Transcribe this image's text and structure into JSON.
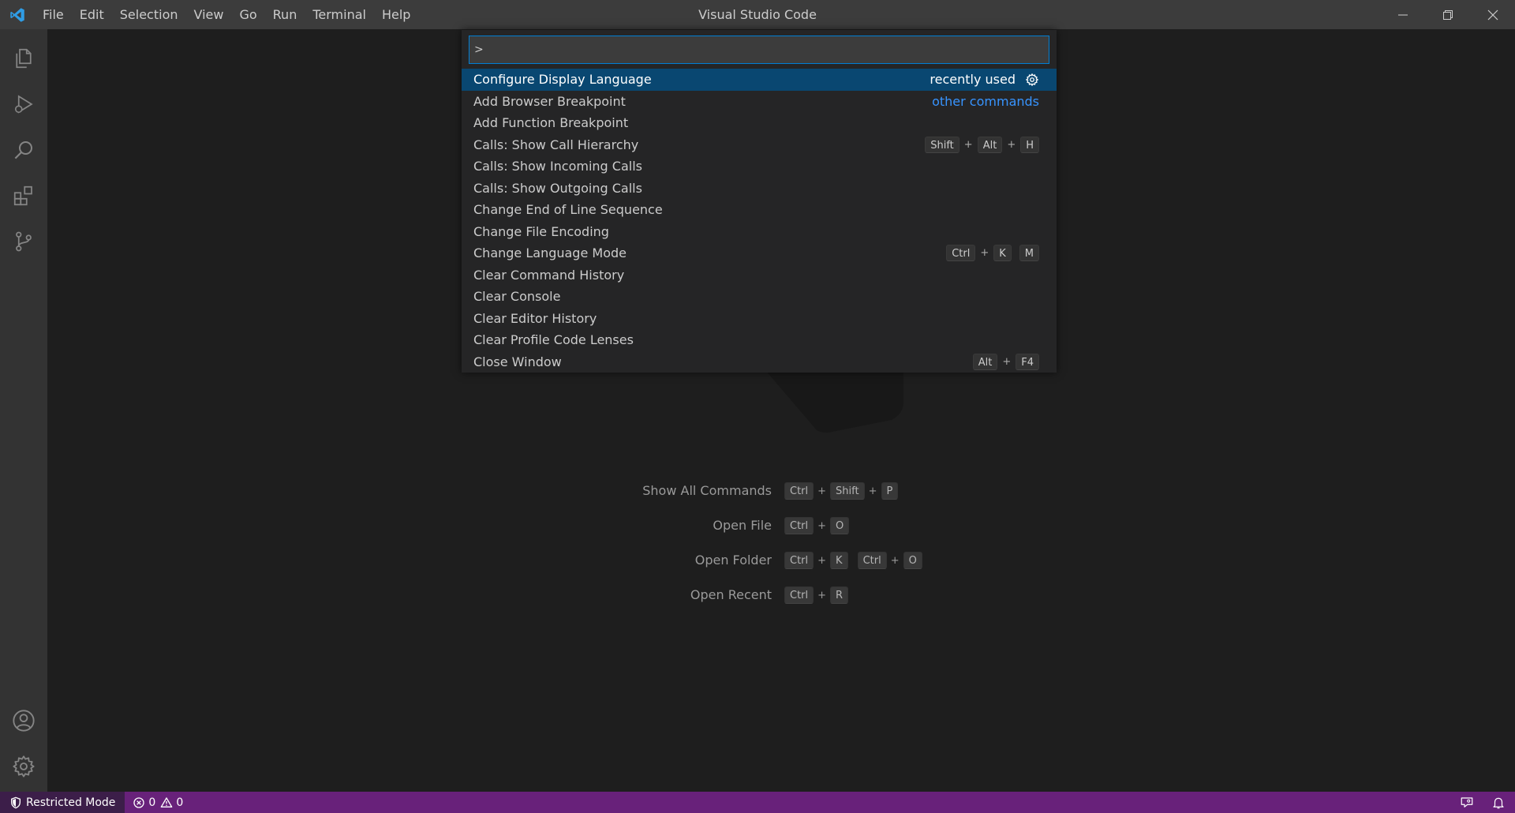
{
  "titlebar": {
    "title": "Visual Studio Code",
    "menu": [
      "File",
      "Edit",
      "Selection",
      "View",
      "Go",
      "Run",
      "Terminal",
      "Help"
    ]
  },
  "activitybar": {
    "top_items": [
      "explorer-icon",
      "run-debug-icon",
      "search-icon",
      "extensions-icon",
      "source-control-icon"
    ],
    "bottom_items": [
      "accounts-icon",
      "manage-gear-icon"
    ]
  },
  "palette": {
    "input_value": ">",
    "items": [
      {
        "label": "Configure Display Language",
        "description": "recently used",
        "gear": true,
        "selected": true
      },
      {
        "label": "Add Browser Breakpoint",
        "link": "other commands"
      },
      {
        "label": "Add Function Breakpoint"
      },
      {
        "label": "Calls: Show Call Hierarchy",
        "keys": [
          "Shift",
          "+",
          "Alt",
          "+",
          "H"
        ]
      },
      {
        "label": "Calls: Show Incoming Calls"
      },
      {
        "label": "Calls: Show Outgoing Calls"
      },
      {
        "label": "Change End of Line Sequence"
      },
      {
        "label": "Change File Encoding"
      },
      {
        "label": "Change Language Mode",
        "keys": [
          "Ctrl",
          "+",
          "K",
          " ",
          "M"
        ]
      },
      {
        "label": "Clear Command History"
      },
      {
        "label": "Clear Console"
      },
      {
        "label": "Clear Editor History"
      },
      {
        "label": "Clear Profile Code Lenses"
      },
      {
        "label": "Close Window",
        "keys": [
          "Alt",
          "+",
          "F4"
        ]
      }
    ]
  },
  "watermark": {
    "entries": [
      {
        "label": "Show All Commands",
        "keys": [
          "Ctrl",
          "+",
          "Shift",
          "+",
          "P"
        ]
      },
      {
        "label": "Open File",
        "keys": [
          "Ctrl",
          "+",
          "O"
        ]
      },
      {
        "label": "Open Folder",
        "keys": [
          "Ctrl",
          "+",
          "K",
          " ",
          "Ctrl",
          "+",
          "O"
        ]
      },
      {
        "label": "Open Recent",
        "keys": [
          "Ctrl",
          "+",
          "R"
        ]
      }
    ]
  },
  "statusbar": {
    "restricted_mode": "Restricted Mode",
    "errors": "0",
    "warnings": "0",
    "colors": {
      "background": "#68217a",
      "restricted_bg": "#3c1e49"
    }
  }
}
